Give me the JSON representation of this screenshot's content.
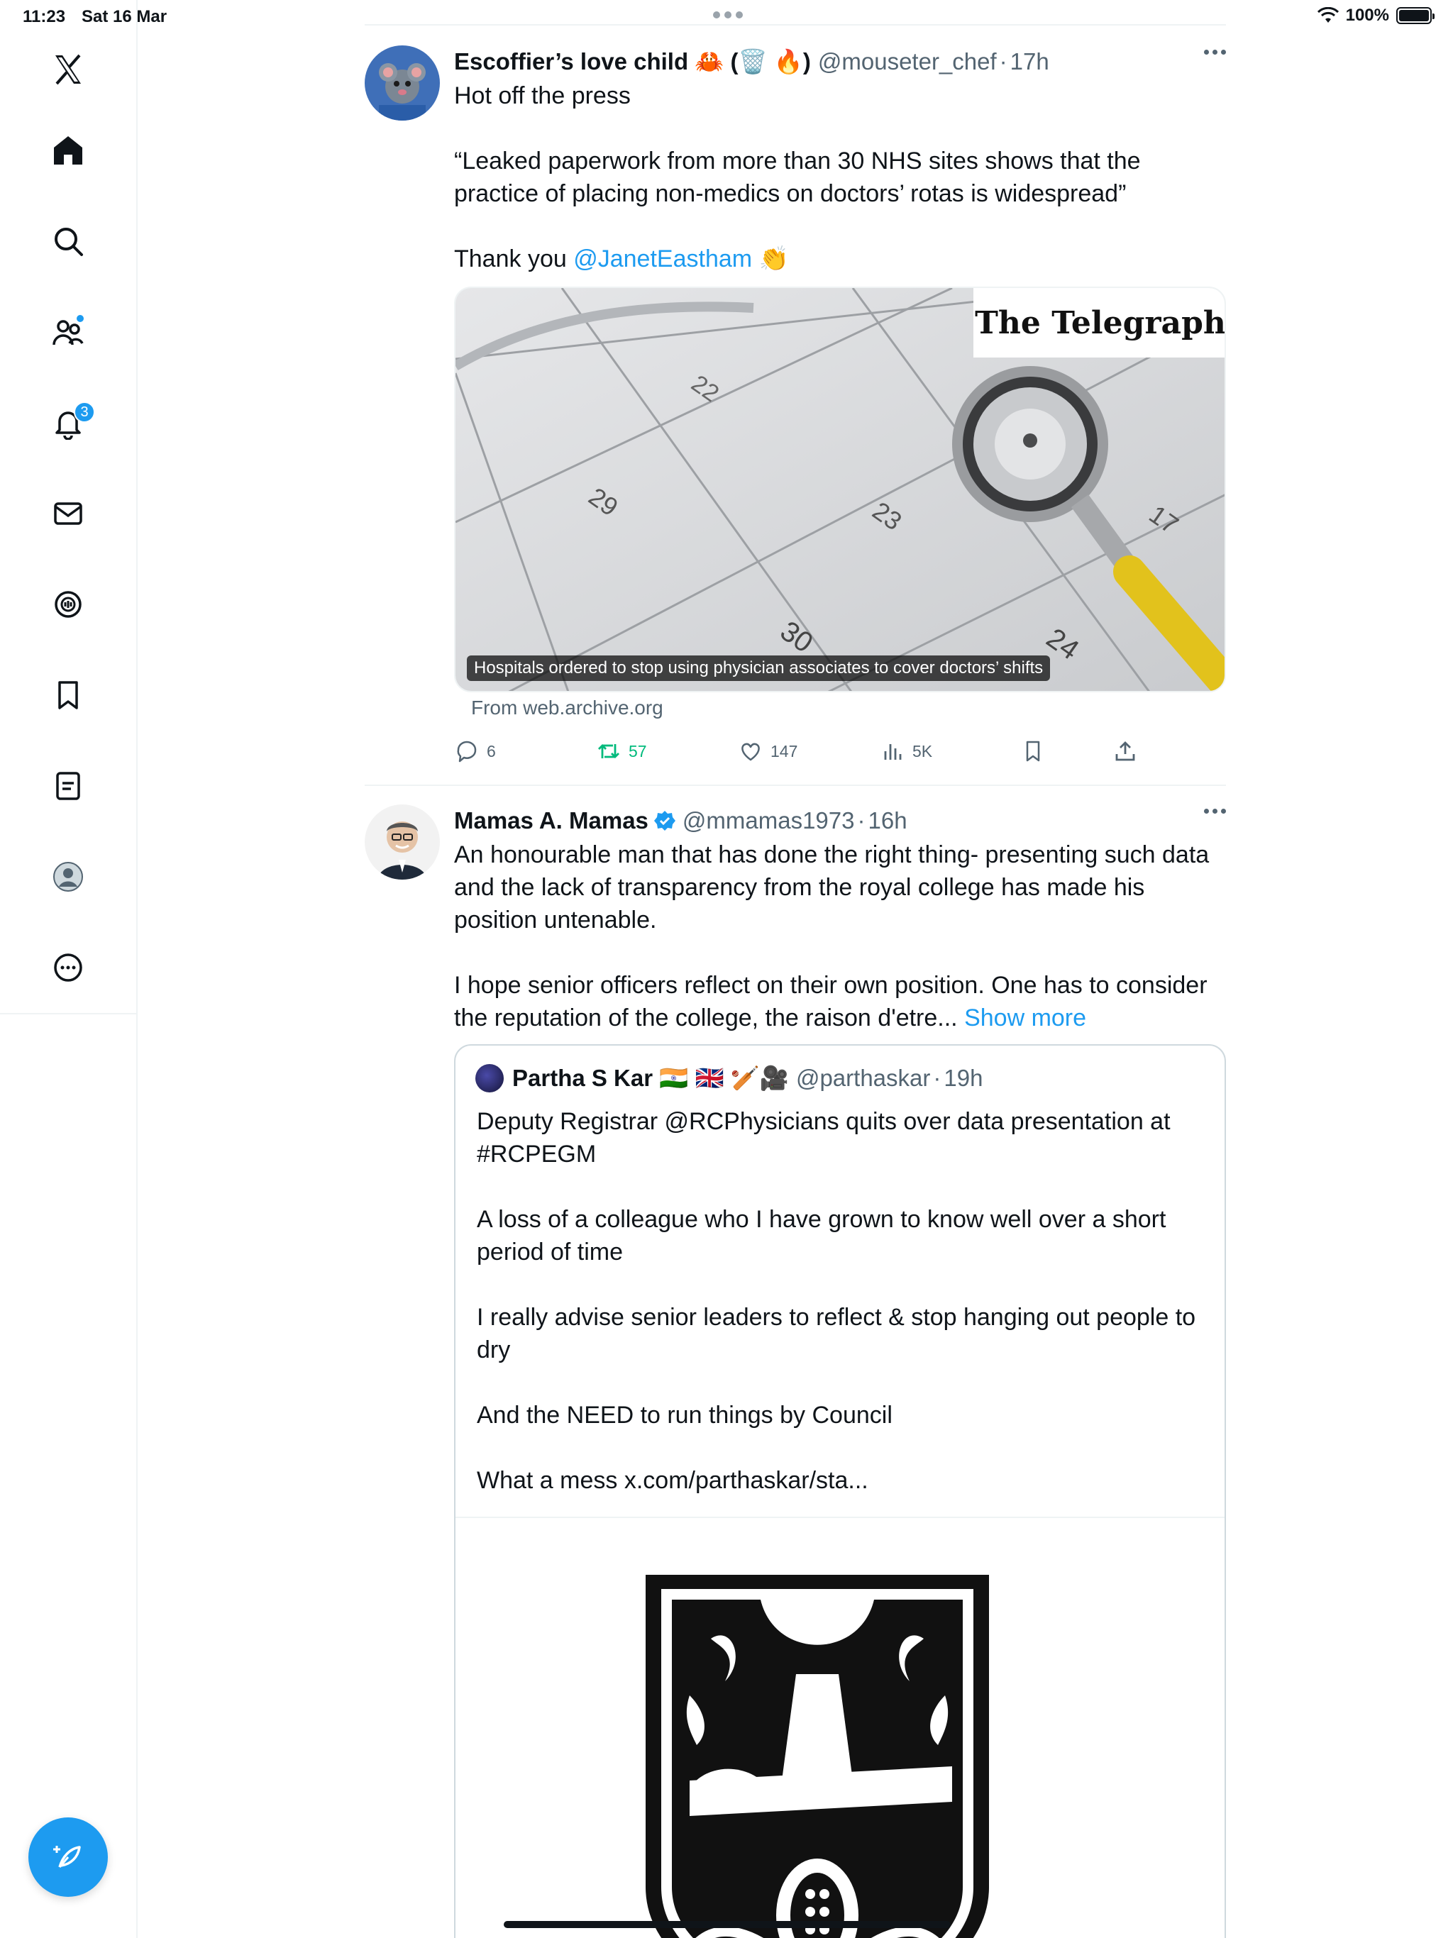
{
  "status_bar": {
    "time": "11:23",
    "date": "Sat 16 Mar",
    "battery": "100%"
  },
  "sidebar": {
    "notifications_badge": "3"
  },
  "tweets": [
    {
      "display_name": "Escoffier’s love child 🦀 (🗑️ 🔥)",
      "handle": "@mouseter_chef",
      "sep": "·",
      "time": "17h",
      "text_1": "Hot off the press",
      "text_2": "“Leaked paperwork from more than 30 NHS sites shows that the practice of placing non-medics on doctors’ rotas is widespread”",
      "text_3_prefix": "Thank you ",
      "mention": "@JanetEastham",
      "emoji": "👏",
      "image_brand": "The Telegraph",
      "image_caption": "Hospitals ordered to stop using physician associates to cover doctors’ shifts",
      "source": "From web.archive.org",
      "replies": "6",
      "retweets": "57",
      "likes": "147",
      "views": "5K"
    },
    {
      "display_name": "Mamas A. Mamas",
      "handle": "@mmamas1973",
      "sep": "·",
      "time": "16h",
      "text_1": "An honourable man that has done the right thing- presenting such data and the lack of transparency from the royal college has made his position untenable.",
      "text_2": "I hope senior officers reflect on their own position. One has to consider the reputation of the college, the raison d'etre... ",
      "show_more": "Show more",
      "quote": {
        "display_name": "Partha S Kar 🇮🇳 🇬🇧 🏏🎥",
        "handle": "@parthaskar",
        "sep": "·",
        "time": "19h",
        "text": "Deputy Registrar @RCPhysicians quits over data presentation at #RCPEGM\n\nA loss of a colleague who I have grown to know well over a short period of time\n\nI really advise senior leaders to reflect & stop hanging out people to dry\n\nAnd the NEED to run things by Council\n\nWhat a mess x.com/parthaskar/sta..."
      }
    }
  ],
  "colors": {
    "accent": "#1d9bf0",
    "retweet": "#00ba7c",
    "secondary_text": "#536471"
  }
}
